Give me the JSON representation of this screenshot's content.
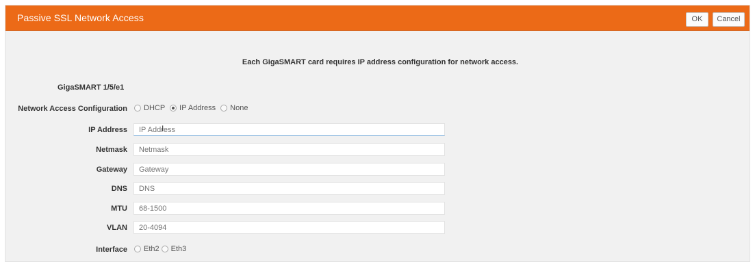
{
  "dialog": {
    "title": "Passive SSL Network Access",
    "ok_label": "OK",
    "cancel_label": "Cancel"
  },
  "intro_text": "Each GigaSMART card requires IP address configuration for network access.",
  "card_label": "GigaSMART 1/5/e1",
  "network_access": {
    "label": "Network Access Configuration",
    "options": [
      {
        "label": "DHCP",
        "selected": false
      },
      {
        "label": "IP Address",
        "selected": true
      },
      {
        "label": "None",
        "selected": false
      }
    ]
  },
  "fields": [
    {
      "label": "IP Address",
      "placeholder": "IP Address",
      "value": ""
    },
    {
      "label": "Netmask",
      "placeholder": "Netmask",
      "value": ""
    },
    {
      "label": "Gateway",
      "placeholder": "Gateway",
      "value": ""
    },
    {
      "label": "DNS",
      "placeholder": "DNS",
      "value": ""
    },
    {
      "label": "MTU",
      "placeholder": "68-1500",
      "value": ""
    },
    {
      "label": "VLAN",
      "placeholder": "20-4094",
      "value": ""
    }
  ],
  "interface": {
    "label": "Interface",
    "options": [
      {
        "label": "Eth2",
        "selected": false
      },
      {
        "label": "Eth3",
        "selected": false
      }
    ]
  }
}
